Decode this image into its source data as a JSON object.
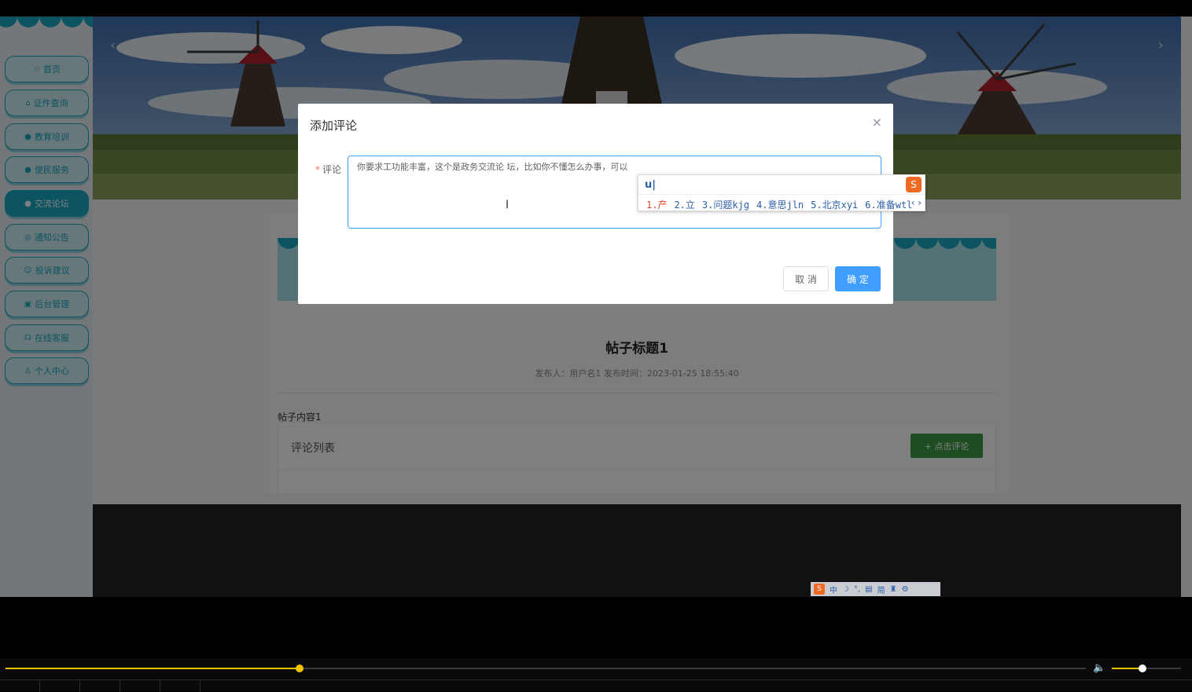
{
  "sidebar": {
    "items": [
      {
        "label": "首页",
        "icon": "star-icon",
        "glyph": "☆",
        "active": false
      },
      {
        "label": "证件查询",
        "icon": "lock-icon",
        "glyph": "⌂",
        "active": false
      },
      {
        "label": "教育培训",
        "icon": "info-icon",
        "glyph": "●",
        "active": false
      },
      {
        "label": "便民服务",
        "icon": "question-icon",
        "glyph": "●",
        "active": false
      },
      {
        "label": "交流论坛",
        "icon": "info-icon",
        "glyph": "●",
        "active": true
      },
      {
        "label": "通知公告",
        "icon": "bell-icon",
        "glyph": "◎",
        "active": false
      },
      {
        "label": "投诉建议",
        "icon": "smile-icon",
        "glyph": "☺",
        "active": false
      },
      {
        "label": "后台管理",
        "icon": "briefcase-icon",
        "glyph": "▣",
        "active": false
      },
      {
        "label": "在线客服",
        "icon": "headset-icon",
        "glyph": "☊",
        "active": false
      },
      {
        "label": "个人中心",
        "icon": "user-icon",
        "glyph": "♙",
        "active": false
      }
    ]
  },
  "banner": {
    "prev_glyph": "‹",
    "next_glyph": "›"
  },
  "post": {
    "title": "帖子标题1",
    "meta": "发布人：用户名1  发布时间：2023-01-25 18:55:40",
    "content": "帖子内容1",
    "comment_list_title": "评论列表",
    "comment_button": "+ 点击评论"
  },
  "dialog": {
    "title": "添加评论",
    "close_glyph": "×",
    "label": "评论",
    "required_mark": "*",
    "textarea_value": "你要求工功能丰富，这个是政务交流论 坛，比如你不懂怎么办事，可以",
    "cancel_label": "取 消",
    "ok_label": "确 定"
  },
  "ime": {
    "input": "u|",
    "candidates": [
      "1.产",
      "2.立",
      "3.问题kjg",
      "4.意思jln",
      "5.北京xyi",
      "6.准备wtl"
    ],
    "nav": "‹ ›",
    "status_items": [
      "中",
      "☽",
      "°,",
      "▤",
      "简",
      "♜",
      "⚙"
    ]
  },
  "player": {
    "progress": 0.272,
    "volume": 0.44,
    "volume_glyph": "🔈"
  },
  "colors": {
    "accent": "#19a9c2",
    "primary_button": "#409eff",
    "comment_button": "#3b9a42",
    "seek": "#f2c400"
  }
}
